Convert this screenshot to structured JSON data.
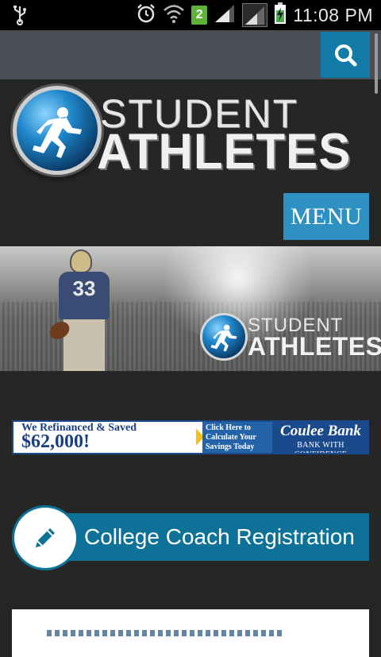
{
  "status_bar": {
    "time": "11:08 PM",
    "sim_number": "2",
    "icons": [
      "usb-icon",
      "alarm-icon",
      "wifi-icon",
      "signal-icon",
      "battery-charging-icon"
    ]
  },
  "header": {
    "search_icon": "search-icon"
  },
  "logo": {
    "line1": "STUDENT",
    "line2": "ATHLETES"
  },
  "nav": {
    "menu_label": "MENU"
  },
  "hero": {
    "jersey_number": "33",
    "logo_line1": "STUDENT",
    "logo_line2": "ATHLETES"
  },
  "ad": {
    "headline": "We Refinanced & Saved",
    "amount": "$62,000!",
    "cta": "Click Here to Calculate Your Savings Today",
    "bank_name": "Coulee Bank",
    "bank_tagline": "BANK WITH CONFIDENCE"
  },
  "section": {
    "title": "College Coach Registration",
    "icon": "pencil-icon"
  },
  "colors": {
    "accent": "#2f90c2",
    "section_bar": "#0e7298",
    "background": "#262626"
  }
}
